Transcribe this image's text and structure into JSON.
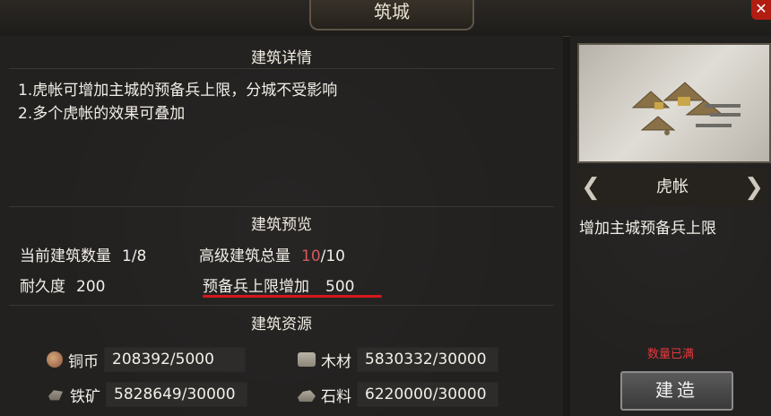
{
  "window": {
    "title": "筑城",
    "close": "✕"
  },
  "details": {
    "title": "建筑详情",
    "lines": [
      "1.虎帐可增加主城的预备兵上限，分城不受影响",
      "2.多个虎帐的效果可叠加"
    ]
  },
  "preview": {
    "title": "建筑预览",
    "current_count_label": "当前建筑数量",
    "current_count_value": "1/8",
    "advanced_total_label": "高级建筑总量",
    "advanced_total_current": "10",
    "advanced_total_max": "/10",
    "durability_label": "耐久度",
    "durability_value": "200",
    "reserve_label": "预备兵上限增加",
    "reserve_value": "500"
  },
  "resources": {
    "title": "建筑资源",
    "items": [
      {
        "icon": "coin-icon",
        "name": "铜币",
        "value": "208392/5000"
      },
      {
        "icon": "wood-icon",
        "name": "木材",
        "value": "5830332/30000"
      },
      {
        "icon": "iron-icon",
        "name": "铁矿",
        "value": "5828649/30000"
      },
      {
        "icon": "stone-icon",
        "name": "石料",
        "value": "6220000/30000"
      }
    ]
  },
  "building": {
    "name": "虎帐",
    "description": "增加主城预备兵上限",
    "status": "数量已满",
    "build_label": "建造",
    "prev_arrow": "❮",
    "next_arrow": "❯"
  },
  "colors": {
    "accent_red": "#d4181b",
    "highlight": "#d35a5a"
  }
}
